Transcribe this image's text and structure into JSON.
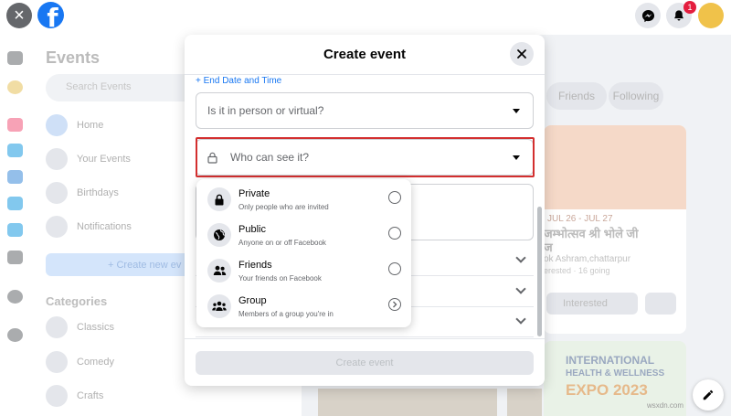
{
  "topbar": {
    "notification_count": "1"
  },
  "sidebar": {
    "title": "Events",
    "search_placeholder": "Search Events",
    "items": [
      {
        "label": "Home"
      },
      {
        "label": "Your Events"
      },
      {
        "label": "Birthdays"
      },
      {
        "label": "Notifications"
      }
    ],
    "create_label": "+ Create new ev",
    "categories_title": "Categories",
    "categories": [
      {
        "label": "Classics"
      },
      {
        "label": "Comedy"
      },
      {
        "label": "Crafts"
      }
    ]
  },
  "background": {
    "filter_pills": [
      "Friends",
      "Following"
    ],
    "card": {
      "date": "JUL 26 - JUL 27",
      "title_line1": "जम्भोत्सव श्री भोले जी",
      "title_line2": "ज",
      "location": "ok Ashram,chattarpur",
      "meta": "erested · 16 going",
      "interested_label": "Interested"
    },
    "expo": {
      "line1": "INTERNATIONAL",
      "line2": "HEALTH & WELLNESS",
      "line3": "EXPO 2023"
    },
    "watermark": "wsxdn.com"
  },
  "modal": {
    "title": "Create event",
    "end_date_link": "+ End Date and Time",
    "location_select": {
      "placeholder": "Is it in person or virtual?"
    },
    "privacy_select": {
      "placeholder": "Who can see it?"
    },
    "create_button": "Create event"
  },
  "privacy_options": [
    {
      "label": "Private",
      "description": "Only people who are invited",
      "icon": "lock-icon",
      "control": "radio"
    },
    {
      "label": "Public",
      "description": "Anyone on or off Facebook",
      "icon": "globe-icon",
      "control": "radio"
    },
    {
      "label": "Friends",
      "description": "Your friends on Facebook",
      "icon": "friends-icon",
      "control": "radio"
    },
    {
      "label": "Group",
      "description": "Members of a group you're in",
      "icon": "group-icon",
      "control": "chevron"
    }
  ],
  "colors": {
    "brand": "#1877f2",
    "highlight": "#d32f2f",
    "badge": "#e41e3f"
  }
}
